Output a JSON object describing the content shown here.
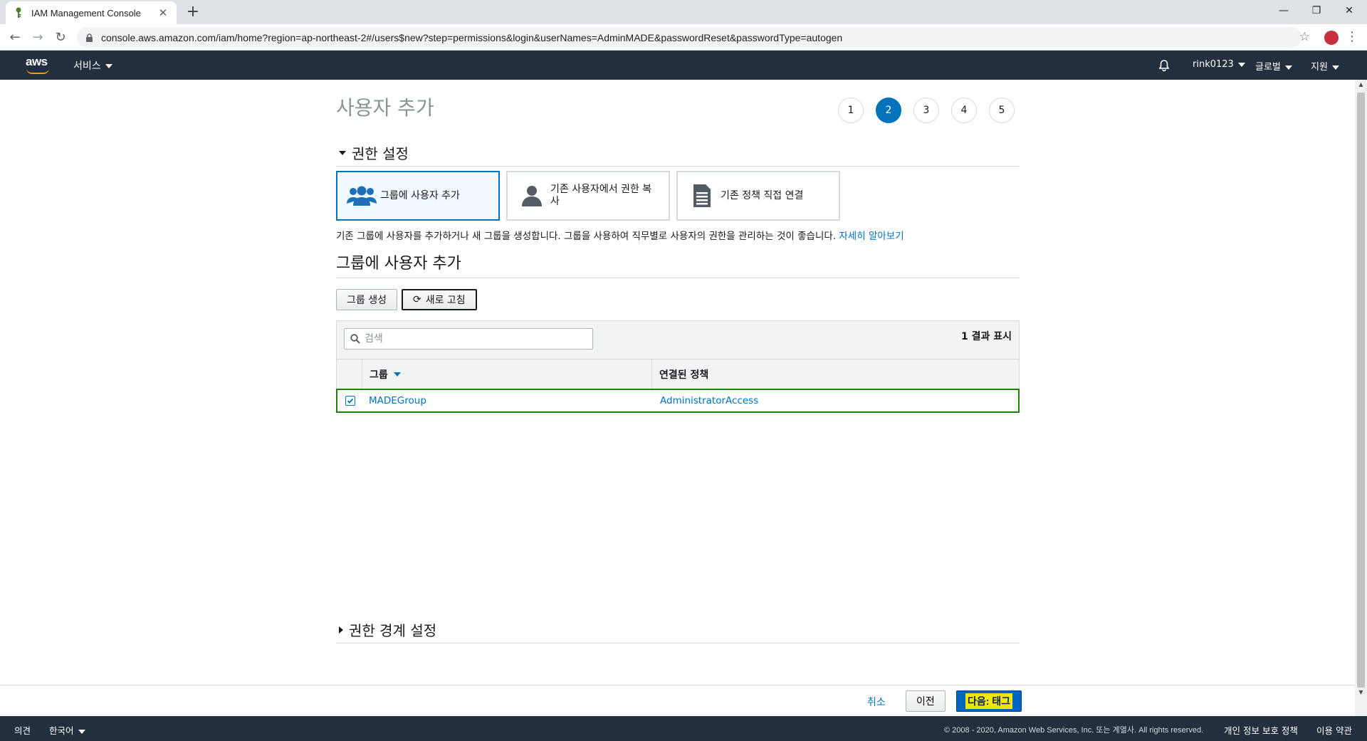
{
  "browser": {
    "tab_title": "IAM Management Console",
    "url": "console.aws.amazon.com/iam/home?region=ap-northeast-2#/users$new?step=permissions&login&userNames=AdminMADE&passwordReset&passwordType=autogen"
  },
  "awsnav": {
    "logo": "aws",
    "services": "서비스",
    "user": "rink0123",
    "region": "글로벌",
    "support": "지원"
  },
  "page": {
    "title": "사용자 추가",
    "steps": [
      "1",
      "2",
      "3",
      "4",
      "5"
    ],
    "active_step": 2
  },
  "permissions": {
    "section_label": "권한 설정",
    "options": [
      {
        "label": "그룹에 사용자 추가",
        "icon": "users-group-icon",
        "selected": true
      },
      {
        "label": "기존 사용자에서 권한 복사",
        "icon": "user-icon",
        "selected": false
      },
      {
        "label": "기존 정책 직접 연결",
        "icon": "document-icon",
        "selected": false
      }
    ],
    "description": "기존 그룹에 사용자를 추가하거나 새 그룹을 생성합니다. 그룹을 사용하여 직무별로 사용자의 권한을 관리하는 것이 좋습니다.",
    "learn_more": "자세히 알아보기"
  },
  "group_section": {
    "title": "그룹에 사용자 추가",
    "create_group": "그룹 생성",
    "refresh": "새로 고침",
    "search_placeholder": "검색",
    "results": "1 결과 표시",
    "columns": [
      "그룹",
      "연결된 정책"
    ],
    "rows": [
      {
        "group": "MADEGroup",
        "policy": "AdministratorAccess",
        "checked": true
      }
    ]
  },
  "boundary": {
    "section_label": "권한 경계 설정"
  },
  "actions": {
    "cancel": "취소",
    "previous": "이전",
    "next": "다음: 태그"
  },
  "footer": {
    "feedback": "의견",
    "language": "한국어",
    "copyright": "© 2008 - 2020, Amazon Web Services, Inc. 또는 계열사. All rights reserved.",
    "privacy": "개인 정보 보호 정책",
    "terms": "이용 약관"
  },
  "colors": {
    "aws_nav": "#232f3e",
    "accent_blue": "#0073bb",
    "selected_row": "#1d8102",
    "aws_orange": "#ff9900"
  }
}
